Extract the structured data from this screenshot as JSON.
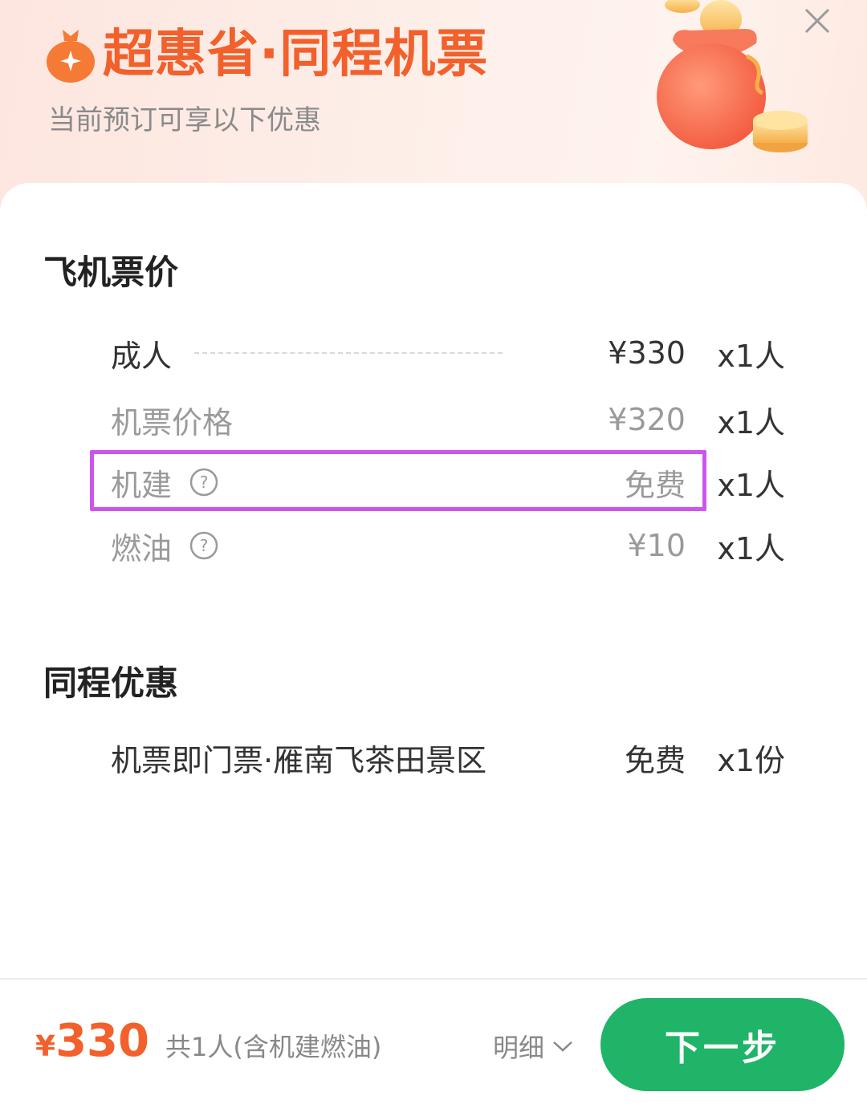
{
  "header": {
    "title": "超惠省·同程机票",
    "subtitle": "当前预订可享以下优惠",
    "close_icon": "close-icon",
    "accent_color": "#f2602c"
  },
  "fare_section": {
    "title": "飞机票价",
    "rows": [
      {
        "label": "成人",
        "price": "¥330",
        "qty": "x1人",
        "style": "dark",
        "help": false
      },
      {
        "label": "机票价格",
        "price": "¥320",
        "qty": "x1人",
        "style": "muted",
        "help": false
      },
      {
        "label": "机建",
        "price": "免费",
        "qty": "x1人",
        "style": "muted",
        "help": true,
        "highlighted": true
      },
      {
        "label": "燃油",
        "price": "¥10",
        "qty": "x1人",
        "style": "muted",
        "help": true
      }
    ]
  },
  "promo_section": {
    "title": "同程优惠",
    "rows": [
      {
        "label": "机票即门票·雁南飞茶田景区",
        "price": "免费",
        "qty": "x1份"
      }
    ]
  },
  "footer": {
    "currency": "¥",
    "total": "330",
    "note": "共1人(含机建燃油)",
    "detail_label": "明细",
    "next_label": "下一步",
    "button_color": "#1fb467"
  },
  "highlight_color": "#cc55ee"
}
